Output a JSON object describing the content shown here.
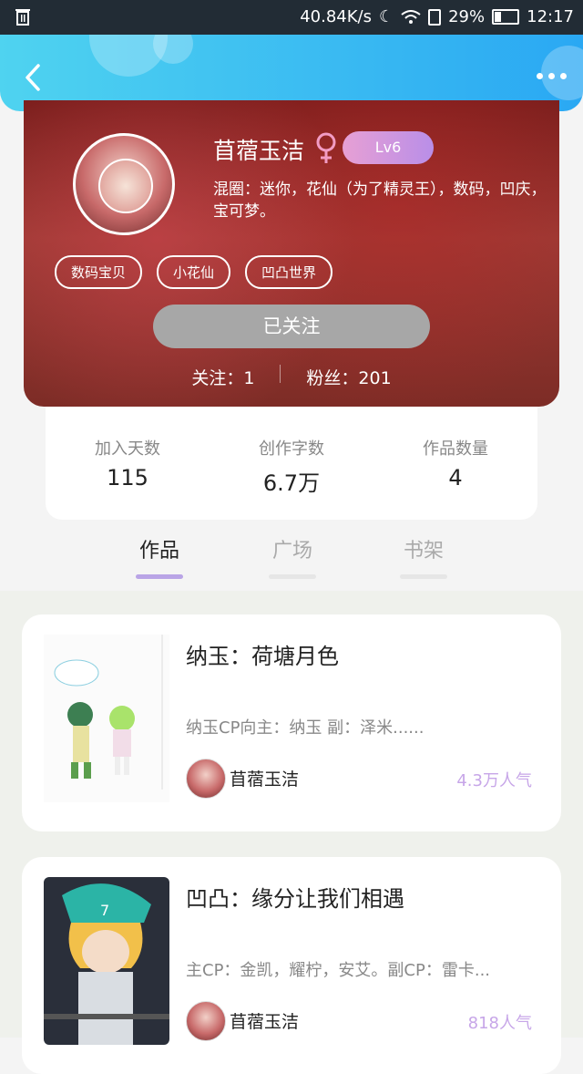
{
  "status_bar": {
    "speed": "40.84K/s",
    "battery": "29%",
    "battery_level": 0.29,
    "time": "12:17"
  },
  "profile": {
    "username": "苜蓿玉洁",
    "level": "Lv6",
    "bio": "混圈：迷你，花仙（为了精灵王），数码，凹庆，宝可梦。",
    "tags": [
      "数码宝贝",
      "小花仙",
      "凹凸世界"
    ],
    "follow_button": "已关注",
    "following": "关注：1",
    "fans": "粉丝：201"
  },
  "stats": [
    {
      "label": "加入天数",
      "value": "115"
    },
    {
      "label": "创作字数",
      "value": "6.7万"
    },
    {
      "label": "作品数量",
      "value": "4"
    }
  ],
  "tabs": [
    "作品",
    "广场",
    "书架"
  ],
  "works": [
    {
      "title": "纳玉：荷塘月色",
      "desc": "纳玉CP向主：纳玉 副：泽米......",
      "author": "苜蓿玉洁",
      "popularity": "4.3万人气"
    },
    {
      "title": "凹凸：缘分让我们相遇",
      "desc": "主CP：金凯，耀柠，安艾。副CP：雷卡...",
      "author": "苜蓿玉洁",
      "popularity": "818人气"
    }
  ],
  "colors": {
    "header": "#2aa8f3",
    "level_badge": "#b98ee8",
    "popularity": "#c7a6e8"
  }
}
